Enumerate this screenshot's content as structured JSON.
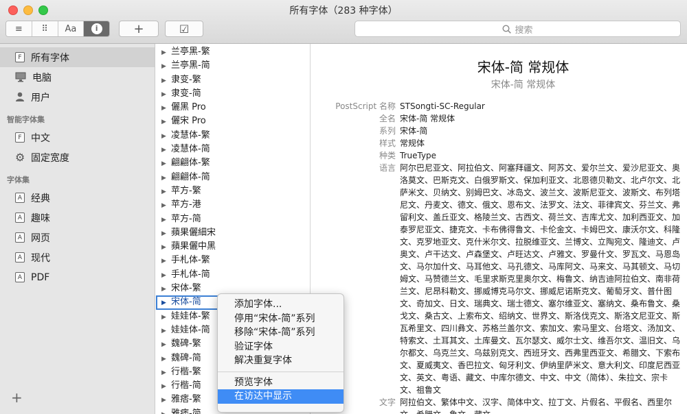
{
  "window": {
    "title": "所有字体（283 种字体）"
  },
  "toolbar": {
    "view_list_icon": "≡",
    "view_grid_icon": "⠿",
    "view_sample_label": "Aa",
    "view_info_icon": "i",
    "add_label": "+",
    "check_label": "☑",
    "search_placeholder": "搜索"
  },
  "sidebar": {
    "items": [
      {
        "label": "所有字体",
        "icon": "F"
      },
      {
        "label": "电脑",
        "icon": "computer"
      },
      {
        "label": "用户",
        "icon": "user"
      }
    ],
    "smart_header": "智能字体集",
    "smart_items": [
      {
        "label": "中文",
        "icon": "F"
      },
      {
        "label": "固定宽度",
        "icon": "gear"
      }
    ],
    "collections_header": "字体集",
    "collection_items": [
      {
        "label": "经典",
        "icon": "A"
      },
      {
        "label": "趣味",
        "icon": "A"
      },
      {
        "label": "网页",
        "icon": "A"
      },
      {
        "label": "现代",
        "icon": "A"
      },
      {
        "label": "PDF",
        "icon": "A"
      }
    ],
    "add_label": "+"
  },
  "font_list": [
    "兰亭黑-繁",
    "兰亭黑-简",
    "隶变-繁",
    "隶变-简",
    "儷黑 Pro",
    "儷宋 Pro",
    "凌慧体-繁",
    "凌慧体-简",
    "翩翩体-繁",
    "翩翩体-简",
    "苹方-繁",
    "苹方-港",
    "苹方-简",
    "蘋果儷細宋",
    "蘋果儷中黑",
    "手札体-繁",
    "手札体-简",
    "宋体-繁",
    "宋体-简",
    "娃娃体-繁",
    "娃娃体-简",
    "魏碑-繁",
    "魏碑-简",
    "行楷-繁",
    "行楷-简",
    "雅痞-繁",
    "雅痞-简"
  ],
  "selected_index": 18,
  "detail": {
    "title": "宋体-简 常规体",
    "subtitle": "宋体-简 常规体",
    "properties": [
      {
        "key": "PostScript 名称",
        "value": "STSongti-SC-Regular"
      },
      {
        "key": "全名",
        "value": "宋体-简 常规体"
      },
      {
        "key": "系列",
        "value": "宋体-简"
      },
      {
        "key": "样式",
        "value": "常规体"
      },
      {
        "key": "种类",
        "value": "TrueType"
      },
      {
        "key": "语言",
        "value": "阿尔巴尼亚文、阿拉伯文、阿塞拜疆文、阿苏文、爱尔兰文、爱沙尼亚文、奥洛莫文、巴斯克文、白俄罗斯文、保加利亚文、北恩德贝勒文、北卢尔文、北萨米文、贝纳文、别姆巴文、冰岛文、波兰文、波斯尼亚文、波斯文、布列塔尼文、丹麦文、德文、俄文、恩布文、法罗文、法文、菲律宾文、芬兰文、弗留利文、盖丘亚文、格陵兰文、古西文、荷兰文、吉库尤文、加利西亚文、加泰罗尼亚文、捷克文、卡布佛得鲁文、卡伦金文、卡姆巴文、康沃尔文、科隆文、克罗地亚文、克什米尔文、拉脱维亚文、兰博文、立陶宛文、隆迪文、卢奥文、卢干达文、卢森堡文、卢旺达文、卢雅文、罗曼什文、罗瓦文、马恩岛文、马尔加什文、马耳他文、马孔德文、马库阿文、马来文、马其顿文、马切姆文、马赞德兰文、毛里求斯克里奥尔文、梅鲁文、纳吉迪阿拉伯文、南非荷兰文、尼昂科勒文、挪威博克马尔文、挪威尼诺斯克文、葡萄牙文、普什图文、奇加文、日文、瑞典文、瑞士德文、塞尔维亚文、塞纳文、桑布鲁文、桑戈文、桑古文、上索布文、绍纳文、世界文、斯洛伐克文、斯洛文尼亚文、斯瓦希里文、四川彝文、苏格兰盖尔文、索加文、索马里文、台塔文、汤加文、特索文、土耳其文、土库曼文、瓦尔瑟文、威尔士文、维吾尔文、温旧文、乌尔都文、乌克兰文、乌兹别克文、西班牙文、西弗里西亚文、希腊文、下索布文、夏威夷文、香巴拉文、匈牙利文、伊纳里萨米文、意大利文、印度尼西亚文、英文、粤语、藏文、中库尔德文、中文、中文（简体）、朱拉文、宗卡文、祖鲁文"
      },
      {
        "key": "文字",
        "value": "阿拉伯文、繁体中文、汉字、简体中文、拉丁文、片假名、平假名、西里尔文、希腊文、象文、藏文"
      }
    ]
  },
  "context_menu": {
    "items_group1": [
      "添加字体...",
      "停用“宋体-简”系列",
      "移除“宋体-简”系列",
      "验证字体",
      "解决重复字体"
    ],
    "items_group2": [
      "预览字体",
      "在访达中显示"
    ],
    "highlighted": "在访达中显示"
  }
}
